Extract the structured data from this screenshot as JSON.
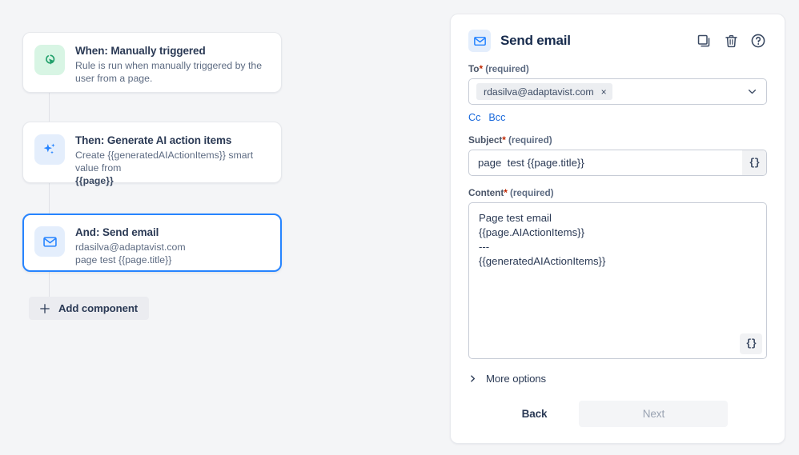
{
  "colors": {
    "page_bg": "#f4f5f7",
    "accent_blue": "#2684ff",
    "link_blue": "#1868db",
    "text_dark": "#172b4d",
    "text_muted": "#5d6b82",
    "required_star": "#bf2600",
    "icon_green_bg": "#d8f5e4",
    "icon_green_fg": "#22a06b",
    "icon_blue_bg": "#e4eefc",
    "icon_blue_fg": "#2684ff"
  },
  "canvas": {
    "cards": [
      {
        "icon": "cursor-click-icon",
        "title": "When: Manually triggered",
        "subtitle": "Rule is run when manually triggered by the user from a page.",
        "strong_line": "",
        "selected": false
      },
      {
        "icon": "ai-sparkles-icon",
        "title": "Then: Generate AI action items",
        "subtitle": "Create {{generatedAIActionItems}} smart value from",
        "strong_line": "{{page}}",
        "selected": false
      },
      {
        "icon": "envelope-icon",
        "title": "And: Send email",
        "subtitle": "rdasilva@adaptavist.com\npage test {{page.title}}",
        "strong_line": "",
        "selected": true
      }
    ],
    "add_component_label": "Add component",
    "add_component_icon": "plus-icon"
  },
  "panel": {
    "header": {
      "icon": "envelope-icon",
      "title": "Send email",
      "actions": [
        {
          "name": "duplicate-icon",
          "tooltip": "Duplicate"
        },
        {
          "name": "trash-icon",
          "tooltip": "Delete"
        },
        {
          "name": "help-icon",
          "tooltip": "Help"
        }
      ]
    },
    "to_field": {
      "label": "To",
      "star": "*",
      "required_text": "(required)",
      "chip_value": "rdasilva@adaptavist.com",
      "chip_remove": "×",
      "dropdown_icon": "chevron-down-icon"
    },
    "cc_links": [
      "Cc",
      "Bcc"
    ],
    "subject_field": {
      "label": "Subject",
      "star": "*",
      "required_text": "(required)",
      "value": "page  test {{page.title}}",
      "placeholder": "",
      "smart_value_button": "{}"
    },
    "content_field": {
      "label": "Content",
      "star": "*",
      "required_text": "(required)",
      "value": "Page test email\n{{page.AIActionItems}}\n---\n{{generatedAIActionItems}}",
      "placeholder": "",
      "smart_value_button": "{}"
    },
    "more_options": {
      "label": "More options",
      "icon": "chevron-right-icon",
      "expanded": false
    },
    "footer": {
      "back_label": "Back",
      "next_label": "Next",
      "next_disabled": true
    }
  }
}
